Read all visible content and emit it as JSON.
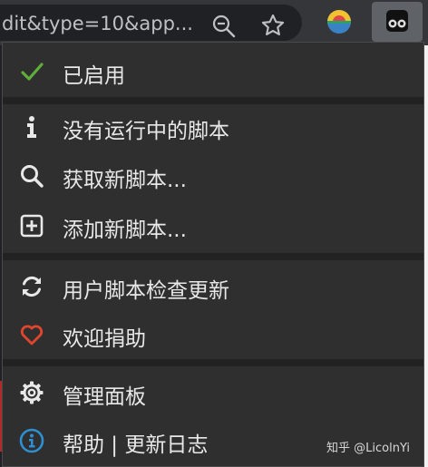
{
  "browser": {
    "url_fragment": "dit&type=10&app..."
  },
  "menu": {
    "items": [
      {
        "label": "已启用",
        "icon": "check-icon"
      },
      {
        "label": "没有运行中的脚本",
        "icon": "info-icon"
      },
      {
        "label": "获取新脚本...",
        "icon": "search-icon"
      },
      {
        "label": "添加新脚本...",
        "icon": "plus-square-icon"
      },
      {
        "label": "用户脚本检查更新",
        "icon": "refresh-icon"
      },
      {
        "label": "欢迎捐助",
        "icon": "heart-icon"
      },
      {
        "label": "管理面板",
        "icon": "gear-icon"
      },
      {
        "label": "帮助 | 更新日志",
        "icon": "info-circle-icon"
      }
    ]
  },
  "watermark": "知乎 @LicolnYi",
  "colors": {
    "check": "#5fae3a",
    "heart": "#e0452f",
    "info_circle": "#2f8fd0",
    "menu_bg": "#2f2f2f",
    "text": "#e8e8e8"
  }
}
